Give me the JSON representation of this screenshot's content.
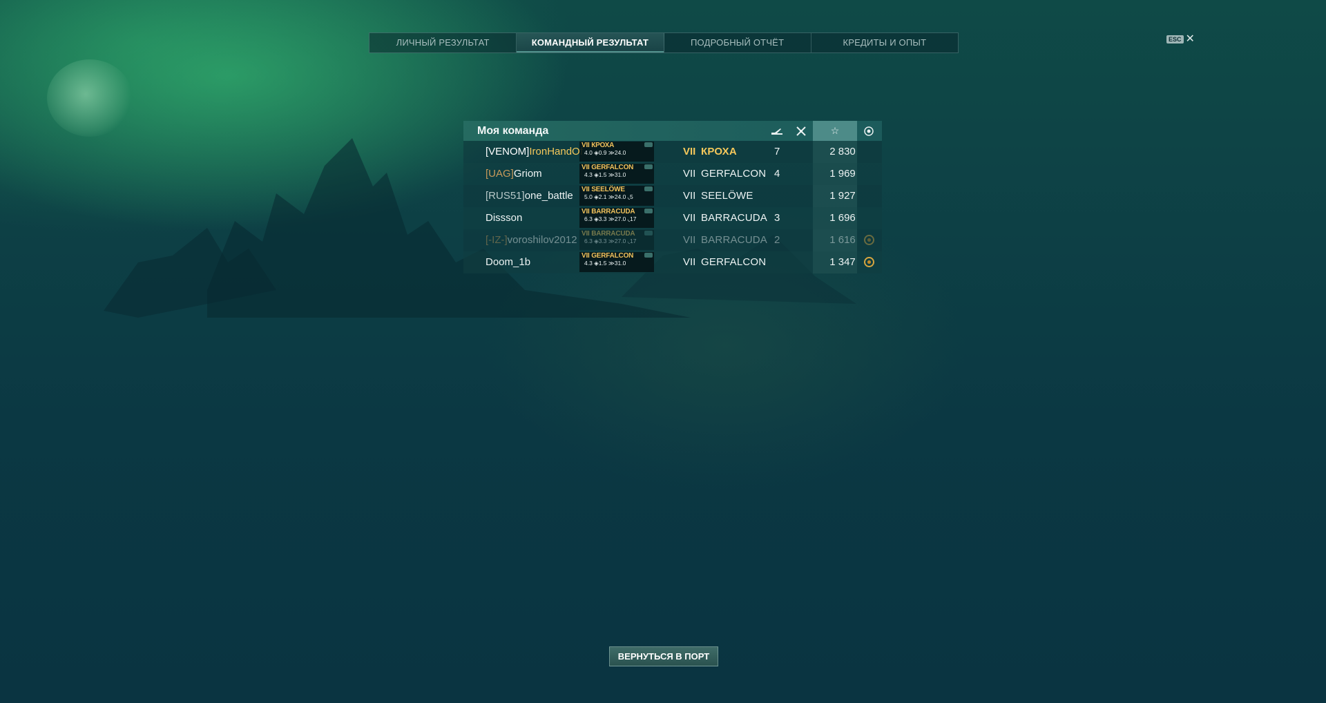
{
  "tabs": [
    {
      "label": "ЛИЧНЫЙ РЕЗУЛЬТАТ",
      "active": false
    },
    {
      "label": "КОМАНДНЫЙ РЕЗУЛЬТАТ",
      "active": true
    },
    {
      "label": "ПОДРОБНЫЙ ОТЧЁТ",
      "active": false
    },
    {
      "label": "КРЕДИТЫ И ОПЫТ",
      "active": false
    }
  ],
  "close": {
    "key": "ESC",
    "glyph": "✕"
  },
  "team": {
    "title": "Моя команда",
    "header_icons": [
      "ship-sunk-icon",
      "plane-shot-icon",
      "star-icon",
      "medal-icon"
    ],
    "players": [
      {
        "clan": "[VENOM]",
        "name": "IronHandOf",
        "card_name": "VII КРОХА",
        "card_stats": "4.0 ◈0.9  ≫24.0",
        "tier": "VII",
        "ship": "КРОХА",
        "kills": "7",
        "score": "2 830",
        "medal": false,
        "me": true
      },
      {
        "clan": "[UAG]",
        "name": "Griom",
        "card_name": "VII GERFALCON",
        "card_stats": "4.3 ◈1.5  ≫31.0",
        "tier": "VII",
        "ship": "GERFALCON",
        "kills": "4",
        "score": "1 969",
        "medal": false
      },
      {
        "clan": "[RUS51]",
        "name": "one_battle",
        "card_name": "VII SEELÖWE",
        "card_stats": "5.0 ◈2.1  ≫24.0 ◟5",
        "tier": "VII",
        "ship": "SEELÖWE",
        "kills": "",
        "score": "1 927",
        "medal": false
      },
      {
        "clan": "",
        "name": "Dissson",
        "card_name": "VII BARRACUDA",
        "card_stats": "6.3 ◈3.3  ≫27.0 ◟17",
        "tier": "VII",
        "ship": "BARRACUDA",
        "kills": "3",
        "score": "1 696",
        "medal": false
      },
      {
        "clan": "[-IZ-]",
        "name": "voroshilov2012",
        "card_name": "VII BARRACUDA",
        "card_stats": "6.3 ◈3.3  ≫27.0 ◟17",
        "tier": "VII",
        "ship": "BARRACUDA",
        "kills": "2",
        "score": "1 616",
        "medal": true,
        "dim": true
      },
      {
        "clan": "",
        "name": "Doom_1b",
        "card_name": "VII GERFALCON",
        "card_stats": "4.3 ◈1.5  ≫31.0",
        "tier": "VII",
        "ship": "GERFALCON",
        "kills": "",
        "score": "1 347",
        "medal": true
      }
    ]
  },
  "return_button": "ВЕРНУТЬСЯ В ПОРТ"
}
